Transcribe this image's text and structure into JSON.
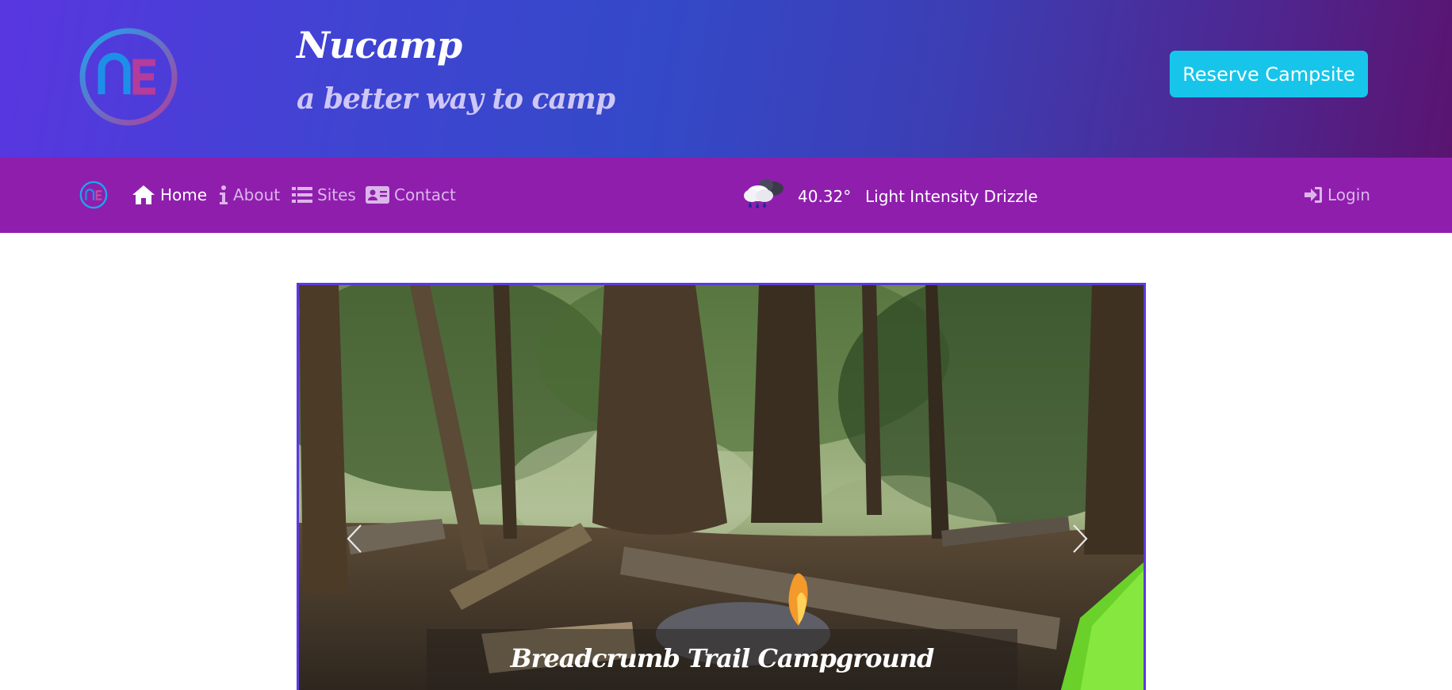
{
  "header": {
    "brand_title": "Nucamp",
    "tagline": "a better way to camp",
    "reserve_button": "Reserve Campsite",
    "logo_icon": "nucamp-logo-icon"
  },
  "navbar": {
    "items": [
      {
        "label": "Home",
        "icon": "home-icon",
        "active": true
      },
      {
        "label": "About",
        "icon": "info-icon",
        "active": false
      },
      {
        "label": "Sites",
        "icon": "list-icon",
        "active": false
      },
      {
        "label": "Contact",
        "icon": "address-card-icon",
        "active": false
      }
    ],
    "weather": {
      "icon": "rain-cloud-icon",
      "temperature": "40.32°",
      "description": "Light Intensity Drizzle"
    },
    "login_label": "Login"
  },
  "carousel": {
    "caption": "Breadcrumb Trail Campground"
  },
  "colors": {
    "navbar": "#8f1ead",
    "reserve_button": "#17c5ea",
    "carousel_border": "#5b3ae0"
  }
}
